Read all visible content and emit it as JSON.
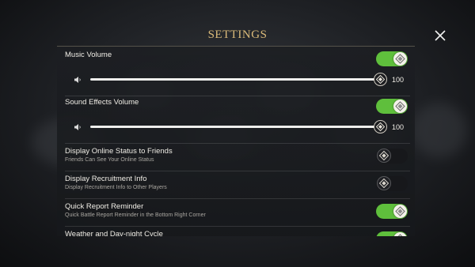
{
  "header": {
    "title": "SETTINGS"
  },
  "settings": {
    "music_volume": {
      "label": "Music Volume",
      "enabled": true,
      "value": "100",
      "level": 1.0
    },
    "sfx_volume": {
      "label": "Sound Effects Volume",
      "enabled": true,
      "value": "100",
      "level": 1.0
    },
    "online_status": {
      "label": "Display Online Status to Friends",
      "description": "Friends Can See Your Online Status",
      "enabled": false
    },
    "recruitment": {
      "label": "Display Recruitment Info",
      "description": "Display Recruitment Info to Other Players",
      "enabled": false
    },
    "quick_report": {
      "label": "Quick Report Reminder",
      "description": "Quick Battle Report Reminder in the Bottom Right Corner",
      "enabled": true
    },
    "weather": {
      "label": "Weather and Day-night Cycle",
      "enabled": true
    }
  },
  "colors": {
    "accent": "#5fbf3c",
    "title": "#d9b979"
  },
  "icons": {
    "close": "close-icon",
    "speaker": "speaker-icon",
    "knob": "diamond-knob-icon"
  }
}
